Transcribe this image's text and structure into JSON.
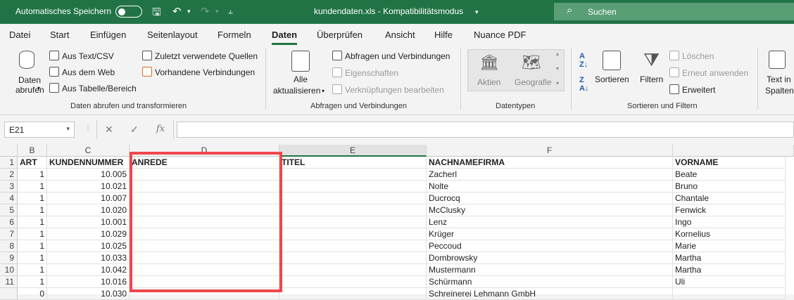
{
  "titlebar": {
    "autosave_label": "Automatisches Speichern",
    "document_title": "kundendaten.xls  -  Kompatibilitätsmodus",
    "search_placeholder": "Suchen"
  },
  "tabs": [
    "Datei",
    "Start",
    "Einfügen",
    "Seitenlayout",
    "Formeln",
    "Daten",
    "Überprüfen",
    "Ansicht",
    "Hilfe",
    "Nuance PDF"
  ],
  "active_tab": "Daten",
  "ribbon": {
    "get_data": {
      "big_button": "Daten abrufen",
      "items": [
        "Aus Text/CSV",
        "Aus dem Web",
        "Aus Tabelle/Bereich"
      ],
      "items2": [
        "Zuletzt verwendete Quellen",
        "Vorhandene Verbindungen"
      ],
      "label": "Daten abrufen und transformieren"
    },
    "queries": {
      "big_button_line1": "Alle",
      "big_button_line2": "aktualisieren",
      "items": [
        "Abfragen und Verbindungen",
        "Eigenschaften",
        "Verknüpfungen bearbeiten"
      ],
      "label": "Abfragen und Verbindungen"
    },
    "datatypes": {
      "items": [
        "Aktien",
        "Geografie"
      ],
      "label": "Datentypen"
    },
    "sort_filter": {
      "sort": "Sortieren",
      "filter": "Filtern",
      "items": [
        "Löschen",
        "Erneut anwenden",
        "Erweitert"
      ],
      "label": "Sortieren und Filtern"
    },
    "text_columns": {
      "line1": "Text in",
      "line2": "Spalten"
    }
  },
  "formula_bar": {
    "name_box": "E21",
    "fx": "fx",
    "value": ""
  },
  "sheet": {
    "column_letters": [
      "B",
      "C",
      "D",
      "E",
      "F",
      ""
    ],
    "row_numbers": [
      "1",
      "2",
      "3",
      "4",
      "5",
      "6",
      "7",
      "8",
      "9",
      "10",
      "11"
    ],
    "headers": [
      "ART",
      "KUNDENNUMMER",
      "ANREDE",
      "TITEL",
      "NACHNAMEFIRMA",
      "VORNAME"
    ],
    "rows": [
      [
        "1",
        "10.005",
        "",
        "",
        "Zacherl",
        "Beate"
      ],
      [
        "1",
        "10.021",
        "",
        "",
        "Nolte",
        "Bruno"
      ],
      [
        "1",
        "10.007",
        "",
        "",
        "Ducrocq",
        "Chantale"
      ],
      [
        "1",
        "10.020",
        "",
        "",
        "McClusky",
        "Fenwick"
      ],
      [
        "1",
        "10.001",
        "",
        "",
        "Lenz",
        "Ingo"
      ],
      [
        "1",
        "10.029",
        "",
        "",
        "Krüger",
        "Kornelius"
      ],
      [
        "1",
        "10.025",
        "",
        "",
        "Peccoud",
        "Marie"
      ],
      [
        "1",
        "10.033",
        "",
        "",
        "Dombrowsky",
        "Martha"
      ],
      [
        "1",
        "10.042",
        "",
        "",
        "Mustermann",
        "Martha"
      ],
      [
        "1",
        "10.016",
        "",
        "",
        "Schürmann",
        "Uli"
      ]
    ],
    "partial_row": [
      "0",
      "10.030",
      "",
      "",
      "Schreinerei Lehmann GmbH",
      ""
    ]
  },
  "colors": {
    "accent": "#217346",
    "highlight": "#f0474a"
  }
}
